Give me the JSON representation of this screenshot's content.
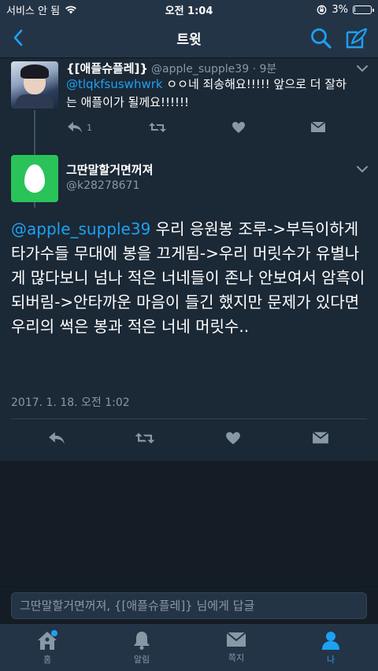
{
  "status_bar": {
    "carrier": "서비스 안 됨",
    "time": "오전 1:04",
    "battery": "3%",
    "battery_level": 0.03
  },
  "nav": {
    "title": "트윗",
    "back_icon": "chevron-left-icon",
    "search_icon": "search-icon",
    "compose_icon": "compose-icon"
  },
  "parent_tweet": {
    "display_name": "{[애플슈플레]}",
    "handle_time": "@apple_supple39 · 9분",
    "mention": "@tlqkfsuswhwrk",
    "text_line1": " ㅇㅇ네 죄송해요!!!!! 앞으로 더 잘하",
    "text_line2": "는 애플이가 될께요!!!!!!",
    "reply_count": "1"
  },
  "focused_tweet": {
    "display_name": "그딴말할거면꺼져",
    "handle": "@k28278671",
    "mention": "@apple_supple39",
    "text": " 우리 응원봉 조루->부득이하게 타가수들 무대에 봉을 끄게됨->우리 머릿수가 유별나게 많다보니 넘나 적은 너네들이 존나 안보여서 암흑이되버림->안타까운 마음이 들긴 했지만 문제가 있다면 우리의 썩은 봉과 적은 너네 머릿수..",
    "timestamp": "2017. 1. 18. 오전 1:02"
  },
  "reply_box": {
    "placeholder": "그딴말할거면꺼져, {[애플슈플레]} 님에게 답글"
  },
  "tab_bar": {
    "items": [
      {
        "label": "홈",
        "icon": "home-icon"
      },
      {
        "label": "알림",
        "icon": "bell-icon"
      },
      {
        "label": "쪽지",
        "icon": "envelope-icon"
      },
      {
        "label": "나",
        "icon": "person-icon"
      }
    ],
    "active": "나"
  },
  "colors": {
    "accent": "#1da1f2",
    "background": "#141d26",
    "card": "#1b2836",
    "muted": "#8899a6",
    "avatar_egg_bg": "#29c35a"
  }
}
